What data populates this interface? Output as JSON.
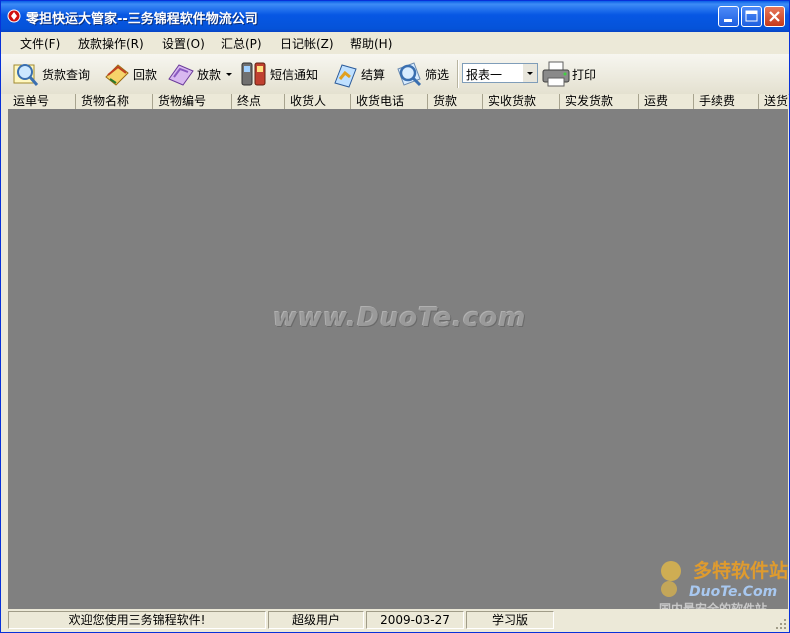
{
  "window": {
    "title": "零担快运大管家--三务锦程软件物流公司"
  },
  "menu": [
    {
      "label": "文件(F)"
    },
    {
      "label": "放款操作(R)"
    },
    {
      "label": "设置(O)"
    },
    {
      "label": "汇总(P)"
    },
    {
      "label": "日记帐(Z)"
    },
    {
      "label": "帮助(H)"
    }
  ],
  "toolbar": {
    "query_label": "货款查询",
    "return_label": "回款",
    "payout_label": "放款",
    "sms_label": "短信通知",
    "settle_label": "结算",
    "filter_label": "筛选",
    "report_select": "报表一",
    "print_label": "打印"
  },
  "columns": [
    "运单号",
    "货物名称",
    "货物编号",
    "终点",
    "收货人",
    "收货电话",
    "货款",
    "实收货款",
    "实发货款",
    "运费",
    "手续费",
    "送货"
  ],
  "watermark": "www.DuoTe.com",
  "logo": {
    "brand": "多特软件站",
    "domain": "DuoTe.Com",
    "slogan": "国内最安全的软件站"
  },
  "status": {
    "welcome": "欢迎您使用三务锦程软件!",
    "user": "超级用户",
    "date": "2009-03-27",
    "edition": "学习版"
  },
  "colors": {
    "title_bar": "#0757e4",
    "grid_bg": "#808080",
    "close_btn": "#c5391a"
  }
}
